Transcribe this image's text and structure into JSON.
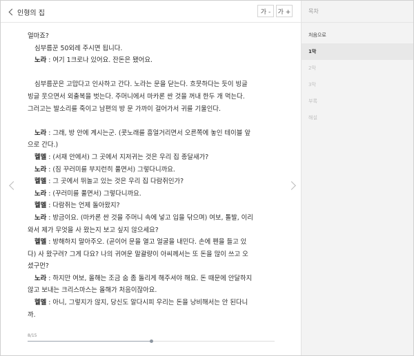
{
  "header": {
    "back_label": "인형의 집",
    "font_decrease_label": "가 -",
    "font_increase_label": "가 +"
  },
  "content": {
    "l1": "얼마죠?",
    "l2": "심부름꾼 50외레 주시면 됩니다.",
    "l3_spk": "노라",
    "l3_txt": " : 여기 1크로나 있어요. 잔돈은 됐어요.",
    "l4": "심부름꾼은 고맙다고 인사하고 간다. 노라는 문을 닫는다. 흐뭇하다는 듯이 빙글",
    "l5": "빙글 웃으면서 외출복을 벗는다. 주머니에서 마카론 싼 것을 꺼내 한두 개 먹는다.",
    "l6": "그러고는 발소리를 죽이고 남편의 방 문 가까이 걸어가서 귀를 기울인다.",
    "l7_spk": "노라",
    "l7_txt": " : 그래, 방 안에 계시는군. (콧노래를 흥얼거리면서 오른쪽에 놓인 테이블 앞",
    "l8": "으로 간다.)",
    "l9_spk": "헬멜",
    "l9_txt": " : (서재 안에서) 그 곳에서 지저귀는 것은 우리 집 종달새가?",
    "l10_spk": "노라",
    "l10_txt": " : (짐 꾸러미를 부지런히 풀면서) 그렇다니까요.",
    "l11_spk": "헬멜",
    "l11_txt": " : 그 곳에서 뛰놀고 있는 것은 우리 집 다람쥐인가?",
    "l12_spk": "노라",
    "l12_txt": " : (꾸러미를 풀면서) 그렇다니까요.",
    "l13_spk": "헬멜",
    "l13_txt": " : 다람쥐는 언제 돌아왔지?",
    "l14_spk": "노라",
    "l14_txt": " : 방금이요. (마카론 싼 것을 주머니 속에 넣고 입을 닦으며) 여보, 톨발, 이리",
    "l15": "와서 제가 무엇을 사 왔는지 보고 싶지 않으세요?",
    "l16_spk": "헬멜",
    "l16_txt": " : 방해하지 말아주오. (곧이어 문을 열고 얼굴을 내민다. 손에 펜을 들고 있",
    "l17": "다) 사 왔구려? 그게 다요? 나의 귀여운 말괄량이 아씨께서는 또 돈을 많이 쓰고 오",
    "l18": "셨구먼?",
    "l19_spk": "노라",
    "l19_txt": " : 하지만 여보, 올해는 조금 숨 좀 돌리게 해주셔야 해요. 돈 때문에 안달하지",
    "l20": "않고 보내는 크리스마스는 올해가 처음이잖아요.",
    "l21_spk": "헬멜",
    "l21_txt": " : 아니, 그렇지가 않지, 당신도 알다시피 우리는 돈을 낭비해서는 안 된다니",
    "l22": "까."
  },
  "progress": {
    "label": "8/15",
    "fraction": 0.5
  },
  "sidebar": {
    "title": "목차",
    "items": [
      {
        "label": "처음으로"
      },
      {
        "label": "1막"
      },
      {
        "label": "2막"
      },
      {
        "label": "3막"
      },
      {
        "label": "부록"
      },
      {
        "label": "해설"
      }
    ]
  }
}
